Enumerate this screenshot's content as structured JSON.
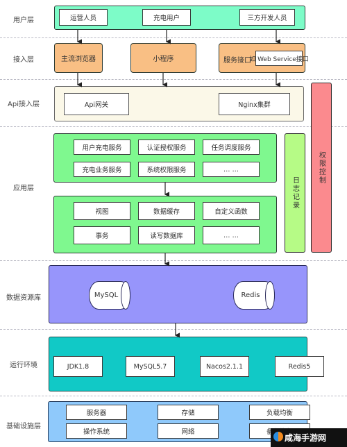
{
  "layers": {
    "user": {
      "label": "用户层",
      "items": [
        "运营人员",
        "充电用户",
        "三方开发人员"
      ],
      "color": "#7dfcc8"
    },
    "access": {
      "label": "接入层",
      "items": [
        "主流浏览器",
        "小程序"
      ],
      "service_label": "服务接口",
      "service_example": "如 Web Service接口",
      "color": "#f9bf84"
    },
    "api": {
      "label": "Api接入层",
      "items": [
        "Api网关",
        "Nginx集群"
      ],
      "color": "#fbf8e8"
    },
    "app": {
      "label": "应用层",
      "services": [
        "用户充电服务",
        "认证授权服务",
        "任务调度服务",
        "充电业务服务",
        "系统权限服务",
        "… …"
      ],
      "data_ops": [
        "视图",
        "数据缓存",
        "自定义函数",
        "事务",
        "读写数据库",
        "… …"
      ],
      "color": "#7ff88f"
    },
    "datasource": {
      "label": "数据资源库",
      "items": [
        "MySQL",
        "Redis"
      ],
      "color": "#9795fb"
    },
    "runtime": {
      "label": "运行环境",
      "items": [
        "JDK1.8",
        "MySQL5.7",
        "Nacos2.1.1",
        "Redis5"
      ],
      "color": "#11c9c6"
    },
    "infra": {
      "label": "基础设施层",
      "items": [
        "服务器",
        "存储",
        "负载均衡",
        "操作系统",
        "网络",
        "备份恢复"
      ],
      "color": "#8fc9fb"
    }
  },
  "side": {
    "logging": {
      "label": "日志记录",
      "color": "#b6fb86"
    },
    "permission": {
      "label": "权限控制",
      "color": "#fb8a8e"
    }
  },
  "watermark": "咸海手游网"
}
